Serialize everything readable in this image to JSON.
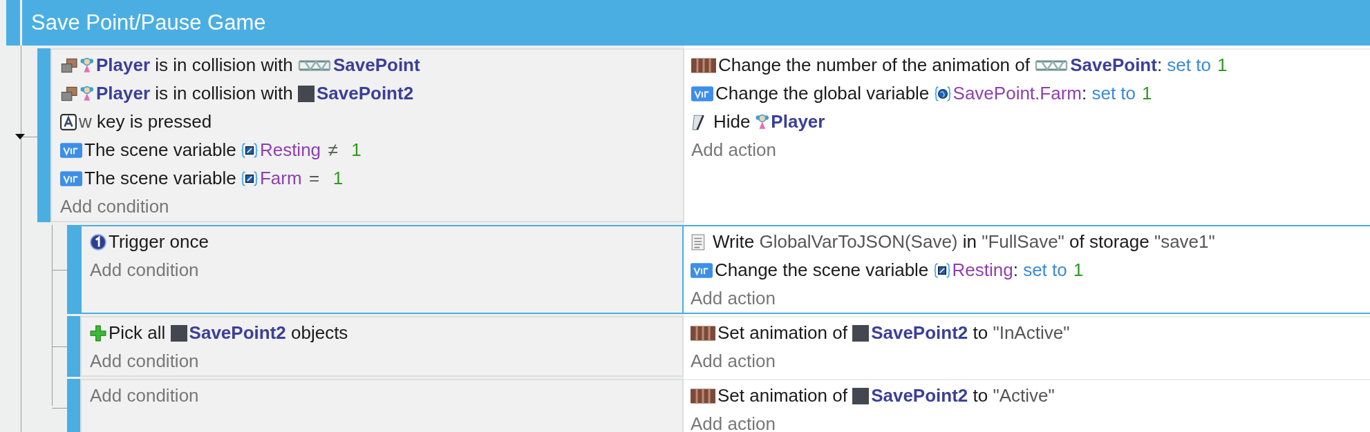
{
  "group": {
    "title": "Save Point/Pause Game",
    "expanded": true
  },
  "events": [
    {
      "selected": false,
      "conditions": [
        {
          "kind": "collision",
          "parts": [
            {
              "kind": "character"
            },
            {
              "kind": "object",
              "text": "Player"
            },
            {
              "kind": "text",
              "text": " is in collision with "
            },
            {
              "kind": "banner"
            },
            {
              "kind": "object",
              "text": "SavePoint"
            }
          ]
        },
        {
          "kind": "collision",
          "parts": [
            {
              "kind": "character"
            },
            {
              "kind": "object",
              "text": "Player"
            },
            {
              "kind": "text",
              "text": " is in collision with "
            },
            {
              "kind": "square"
            },
            {
              "kind": "object",
              "text": "SavePoint2"
            }
          ]
        },
        {
          "kind": "key",
          "parts": [
            {
              "kind": "expr",
              "text": "w"
            },
            {
              "kind": "text",
              "text": " key is pressed"
            }
          ]
        },
        {
          "kind": "var",
          "parts": [
            {
              "kind": "text",
              "text": "The scene variable "
            },
            {
              "kind": "scene"
            },
            {
              "kind": "variable",
              "text": "Resting"
            },
            {
              "kind": "sym",
              "text": "≠"
            },
            {
              "kind": "number",
              "text": "1"
            }
          ]
        },
        {
          "kind": "var",
          "parts": [
            {
              "kind": "text",
              "text": "The scene variable "
            },
            {
              "kind": "scene"
            },
            {
              "kind": "variable",
              "text": "Farm"
            },
            {
              "kind": "sym",
              "text": "="
            },
            {
              "kind": "number",
              "text": "1"
            }
          ]
        }
      ],
      "add_condition": "Add condition",
      "actions": [
        {
          "kind": "animation",
          "parts": [
            {
              "kind": "text",
              "text": "Change the number of the animation of "
            },
            {
              "kind": "banner"
            },
            {
              "kind": "object",
              "text": "SavePoint"
            },
            {
              "kind": "text",
              "text": ": "
            },
            {
              "kind": "op",
              "text": "set to"
            },
            {
              "kind": "number",
              "text": "1"
            }
          ]
        },
        {
          "kind": "var",
          "parts": [
            {
              "kind": "text",
              "text": "Change the global variable "
            },
            {
              "kind": "global"
            },
            {
              "kind": "variable",
              "text": "SavePoint.Farm"
            },
            {
              "kind": "text",
              "text": ": "
            },
            {
              "kind": "op",
              "text": "set to"
            },
            {
              "kind": "number",
              "text": "1"
            }
          ]
        },
        {
          "kind": "hide",
          "parts": [
            {
              "kind": "text",
              "text": " Hide "
            },
            {
              "kind": "character"
            },
            {
              "kind": "object",
              "text": "Player"
            }
          ]
        }
      ],
      "add_action": "Add action",
      "children": [
        {
          "selected": true,
          "conditions": [
            {
              "kind": "trigger",
              "parts": [
                {
                  "kind": "text",
                  "text": "Trigger once"
                }
              ]
            }
          ],
          "add_condition": "Add condition",
          "actions": [
            {
              "kind": "storage",
              "parts": [
                {
                  "kind": "text",
                  "text": " Write "
                },
                {
                  "kind": "expr",
                  "text": "GlobalVarToJSON(Save)"
                },
                {
                  "kind": "text",
                  "text": " in "
                },
                {
                  "kind": "expr",
                  "text": "\"FullSave\""
                },
                {
                  "kind": "text",
                  "text": " of storage "
                },
                {
                  "kind": "expr",
                  "text": "\"save1\""
                }
              ]
            },
            {
              "kind": "var",
              "parts": [
                {
                  "kind": "text",
                  "text": "Change the scene variable "
                },
                {
                  "kind": "scene"
                },
                {
                  "kind": "variable",
                  "text": "Resting"
                },
                {
                  "kind": "text",
                  "text": ": "
                },
                {
                  "kind": "op",
                  "text": "set to"
                },
                {
                  "kind": "number",
                  "text": "1"
                }
              ]
            }
          ],
          "add_action": "Add action"
        },
        {
          "selected": false,
          "conditions": [
            {
              "kind": "pick",
              "parts": [
                {
                  "kind": "text",
                  "text": "Pick all "
                },
                {
                  "kind": "square"
                },
                {
                  "kind": "object",
                  "text": "SavePoint2"
                },
                {
                  "kind": "text",
                  "text": " objects"
                }
              ]
            }
          ],
          "add_condition": "Add condition",
          "actions": [
            {
              "kind": "animation",
              "parts": [
                {
                  "kind": "text",
                  "text": "Set animation of "
                },
                {
                  "kind": "square"
                },
                {
                  "kind": "object",
                  "text": "SavePoint2"
                },
                {
                  "kind": "text",
                  "text": " to "
                },
                {
                  "kind": "expr",
                  "text": "\"InActive\""
                }
              ]
            }
          ],
          "add_action": "Add action"
        },
        {
          "selected": false,
          "add_condition": "Add condition",
          "actions": [
            {
              "kind": "animation",
              "parts": [
                {
                  "kind": "text",
                  "text": "Set animation of "
                },
                {
                  "kind": "square"
                },
                {
                  "kind": "object",
                  "text": "SavePoint2"
                },
                {
                  "kind": "text",
                  "text": " to "
                },
                {
                  "kind": "expr",
                  "text": "\"Active\""
                }
              ]
            }
          ],
          "add_action": "Add action"
        }
      ]
    }
  ]
}
